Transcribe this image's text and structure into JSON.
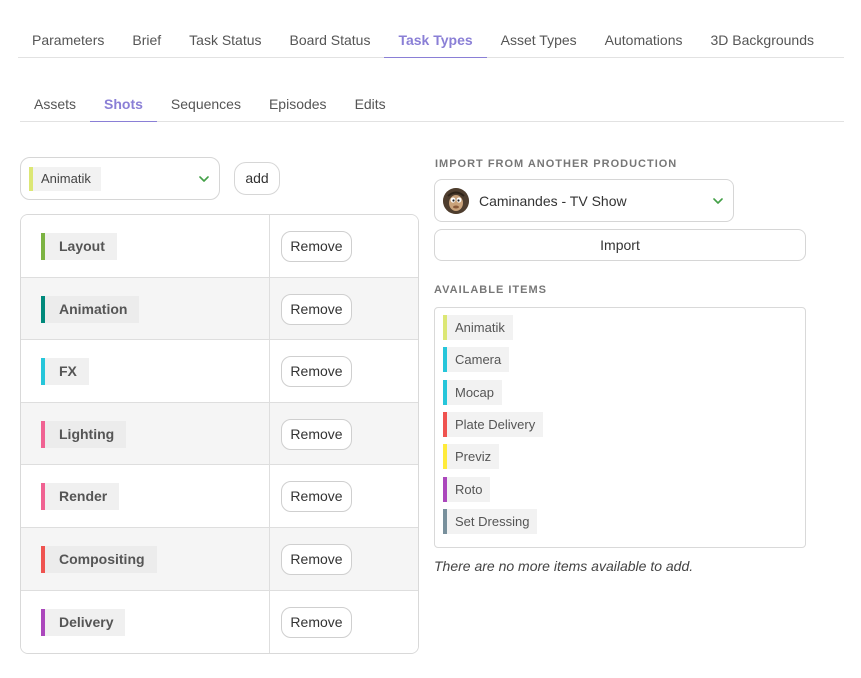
{
  "main_tabs": [
    "Parameters",
    "Brief",
    "Task Status",
    "Board Status",
    "Task Types",
    "Asset Types",
    "Automations",
    "3D Backgrounds"
  ],
  "main_active": "Task Types",
  "sub_tabs": [
    "Assets",
    "Shots",
    "Sequences",
    "Episodes",
    "Edits"
  ],
  "sub_active": "Shots",
  "selector": {
    "value": "Animatik",
    "color": "#dce775"
  },
  "add_label": "add",
  "task_types": [
    {
      "name": "Layout",
      "color": "#7cb342"
    },
    {
      "name": "Animation",
      "color": "#00897b"
    },
    {
      "name": "FX",
      "color": "#26c6da"
    },
    {
      "name": "Lighting",
      "color": "#f06292"
    },
    {
      "name": "Render",
      "color": "#f06292"
    },
    {
      "name": "Compositing",
      "color": "#ef5350"
    },
    {
      "name": "Delivery",
      "color": "#ab47bc"
    }
  ],
  "remove_label": "Remove",
  "import": {
    "title": "IMPORT FROM ANOTHER PRODUCTION",
    "production": "Caminandes - TV Show",
    "button": "Import"
  },
  "available": {
    "title": "AVAILABLE ITEMS",
    "items": [
      {
        "name": "Animatik",
        "color": "#dce775"
      },
      {
        "name": "Camera",
        "color": "#26c6da"
      },
      {
        "name": "Mocap",
        "color": "#26c6da"
      },
      {
        "name": "Plate Delivery",
        "color": "#ef5350"
      },
      {
        "name": "Previz",
        "color": "#ffeb3b"
      },
      {
        "name": "Roto",
        "color": "#ab47bc"
      },
      {
        "name": "Set Dressing",
        "color": "#78909c"
      }
    ],
    "empty_message": "There are no more items available to add."
  },
  "colors": {
    "accent": "#8a7fd6",
    "chevron": "#43a047"
  }
}
